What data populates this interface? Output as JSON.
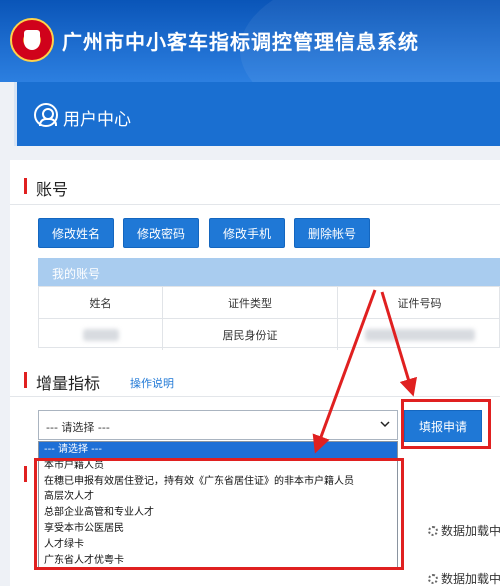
{
  "app": {
    "title": "广州市中小客车指标调控管理信息系统"
  },
  "banner": {
    "title": "用户中心"
  },
  "account": {
    "section_title": "账号",
    "buttons": [
      "修改姓名",
      "修改密码",
      "修改手机",
      "删除帐号"
    ],
    "my_account_label": "我的账号",
    "columns": [
      "姓名",
      "证件类型",
      "证件号码"
    ],
    "row": {
      "id_type": "居民身份证"
    }
  },
  "quota": {
    "section_title": "增量指标",
    "help_link": "操作说明",
    "select_placeholder": "--- 请选择 ---",
    "apply_button": "填报申请",
    "options": [
      "--- 请选择 ---",
      "本市户籍人员",
      "在穗已申报有效居住登记，持有效《广东省居住证》的非本市户籍人员",
      "高层次人才",
      "总部企业高管和专业人才",
      "享受本市公医居民",
      "人才绿卡",
      "广东省人才优粤卡"
    ],
    "selected_index": 0
  },
  "loading_text": "数据加载中",
  "colors": {
    "accent": "#1f78d6",
    "highlight": "#e02020",
    "header": "#0a55b8"
  }
}
